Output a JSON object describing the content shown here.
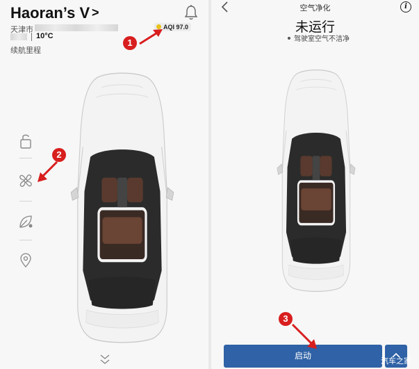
{
  "home": {
    "vehicle_name": "Haoran’s V",
    "vehicle_chevron": ">",
    "city": "天津市",
    "aqi": "AQI 97.0",
    "temperature": "10°C",
    "range_label": "续航里程",
    "icons": [
      "bell-icon",
      "lock-icon",
      "fan-icon",
      "leaf-icon",
      "location-icon",
      "chevron-down-icon"
    ]
  },
  "air_purifier": {
    "title": "空气净化",
    "status": "未运行",
    "substatus": "驾驶室空气不洁净",
    "start_button": "启动",
    "icons": [
      "back-icon",
      "info-icon",
      "chevron-up-icon"
    ]
  },
  "annotations": {
    "step_1": "1",
    "step_2": "2",
    "step_3": "3",
    "color": "#d81e1e"
  },
  "watermark": "汽车之家",
  "colors": {
    "primary_button": "#2f62a6",
    "aqi_dot": "#e8c21a",
    "interior": "#5a3a2e"
  }
}
